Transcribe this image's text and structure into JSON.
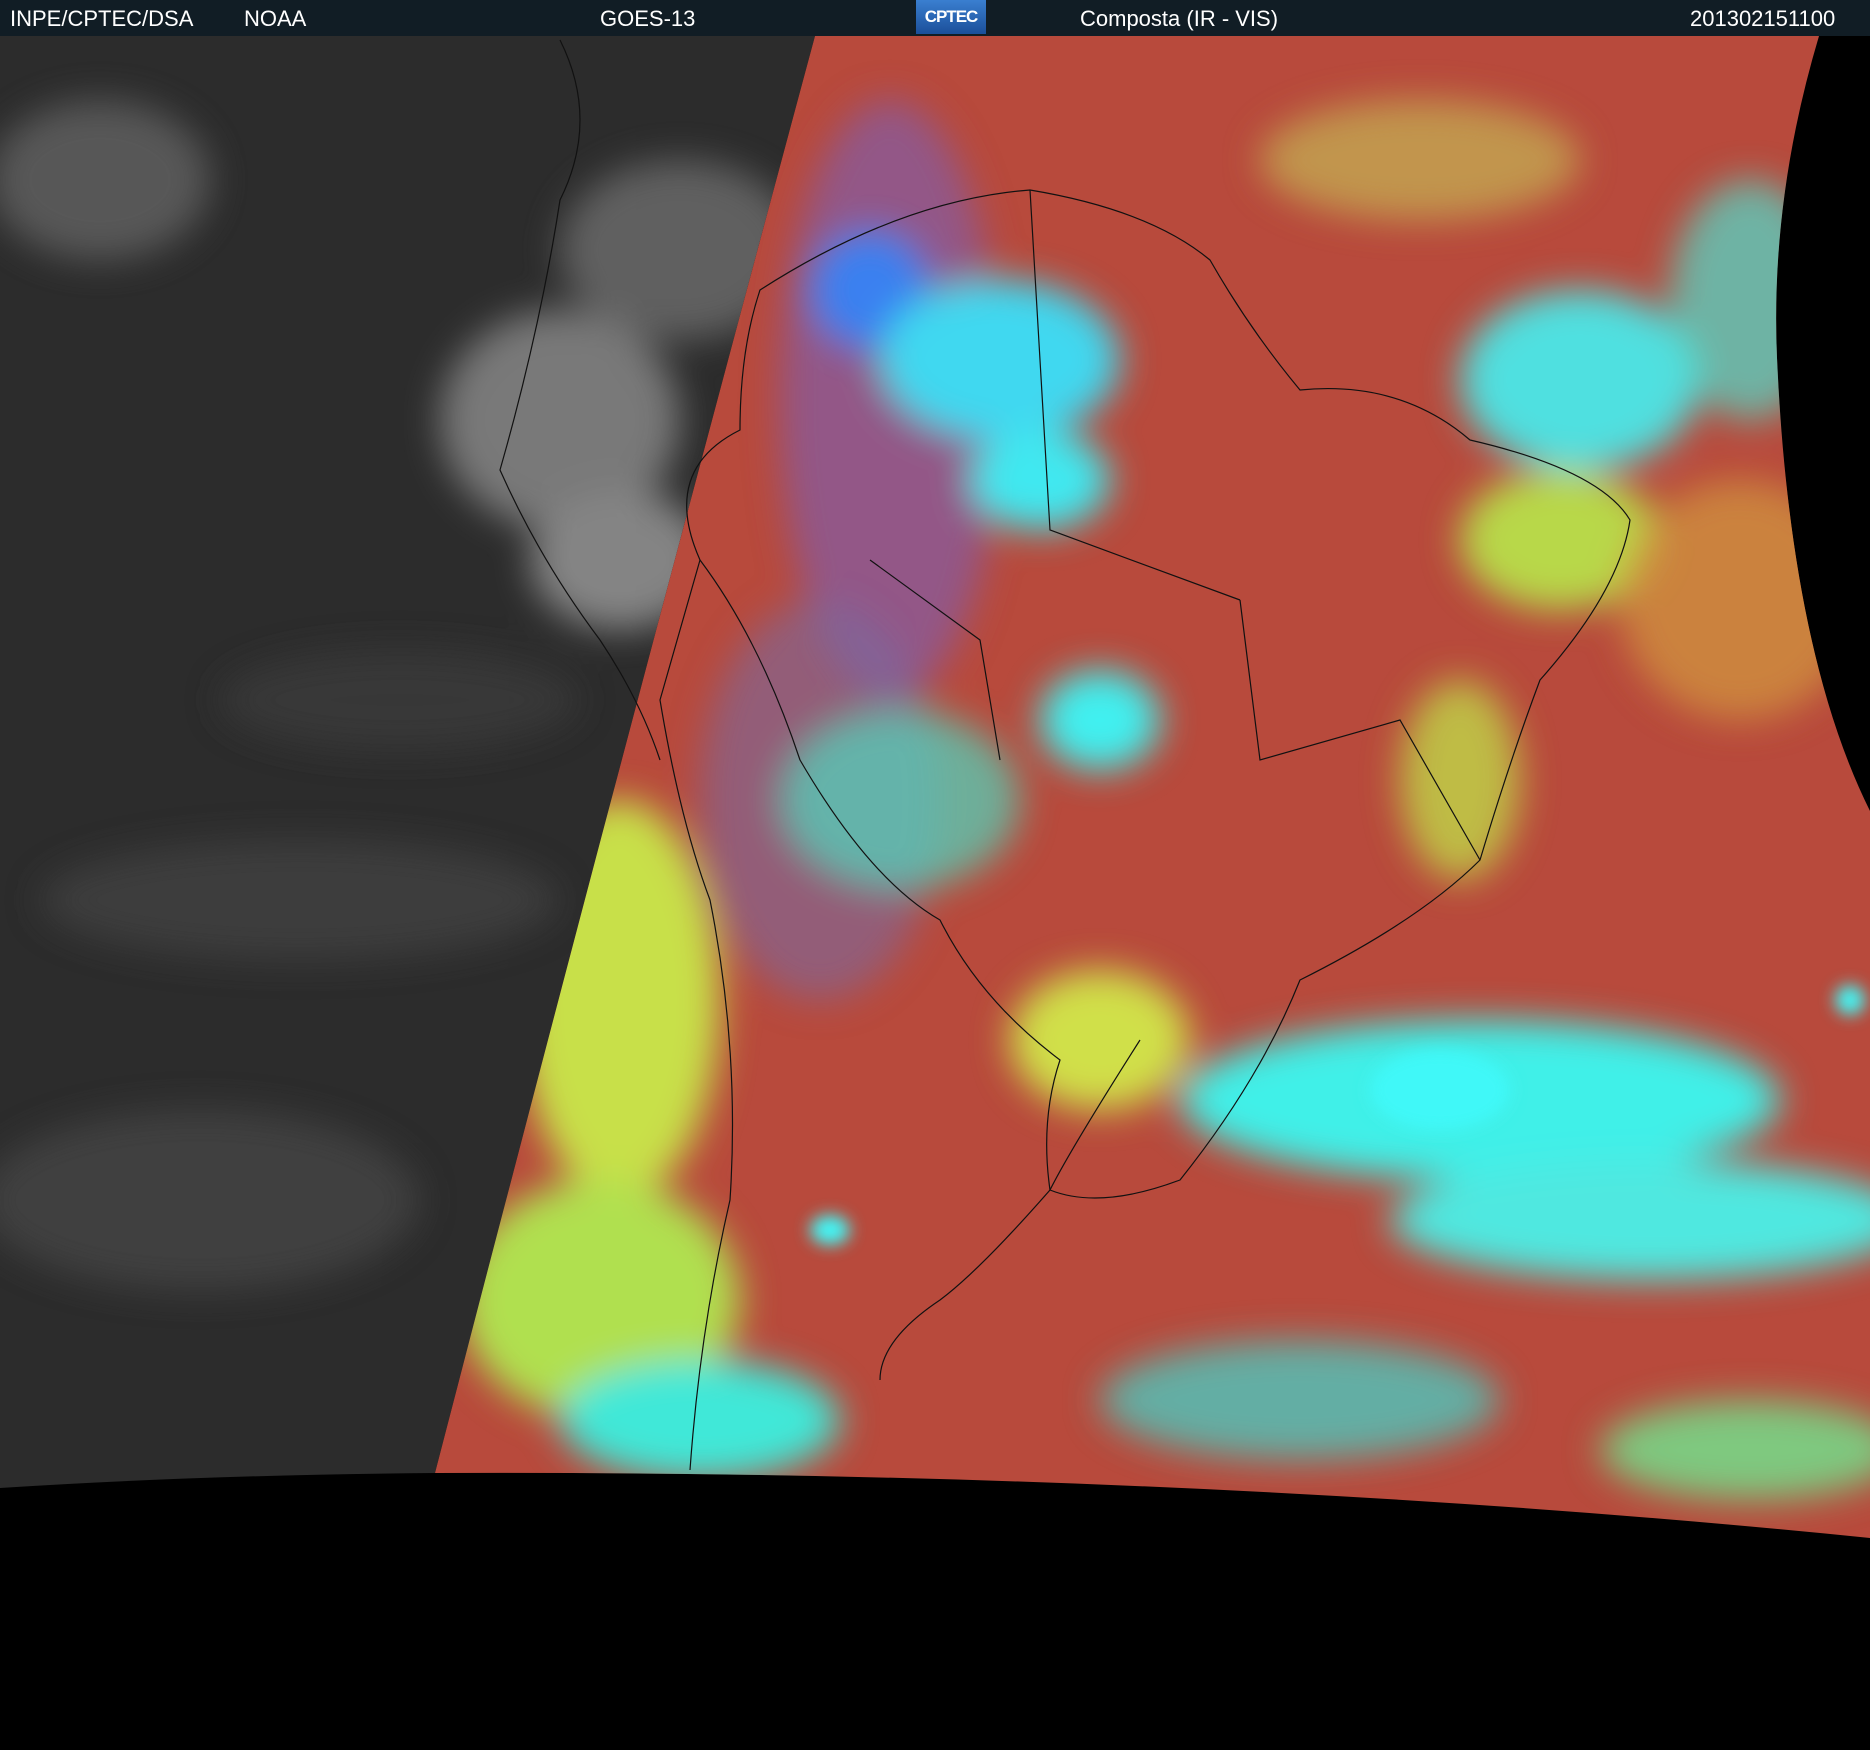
{
  "header": {
    "agency": "INPE/CPTEC/DSA",
    "source": "NOAA",
    "satellite": "GOES-13",
    "logo_text": "CPTEC",
    "product": "Composta (IR - VIS)",
    "datetime": "201302151100"
  },
  "colors": {
    "header_bg": "#111d25",
    "ir_gray": "#2e2e2e",
    "composite_red": "#b84a3c",
    "cloud_cyan": "#3ef0ee",
    "cloud_yellow": "#c8e048"
  }
}
